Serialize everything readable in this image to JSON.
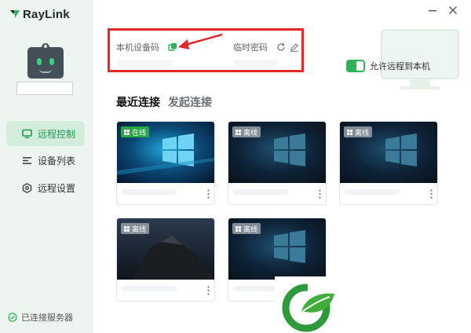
{
  "app": {
    "name": "RayLink"
  },
  "sidebar": {
    "items": [
      {
        "label": "远程控制",
        "active": true
      },
      {
        "label": "设备列表",
        "active": false
      },
      {
        "label": "远程设置",
        "active": false
      }
    ],
    "status": "已连接服务器"
  },
  "device_info": {
    "code_label": "本机设备码",
    "password_label": "临时密码"
  },
  "allow_remote": {
    "label": "允许远程到本机",
    "enabled": true
  },
  "tabs": [
    {
      "label": "最近连接",
      "active": true
    },
    {
      "label": "发起连接",
      "active": false
    }
  ],
  "devices": [
    {
      "status": "在线",
      "online": true
    },
    {
      "status": "离线",
      "online": false
    },
    {
      "status": "离线",
      "online": false
    },
    {
      "status": "离线",
      "online": false
    },
    {
      "status": "离线",
      "online": false
    }
  ],
  "colors": {
    "accent": "#2fb25a",
    "online": "#28a745",
    "highlight": "#e3282a",
    "sidebar_bg": "#eef5f0"
  }
}
